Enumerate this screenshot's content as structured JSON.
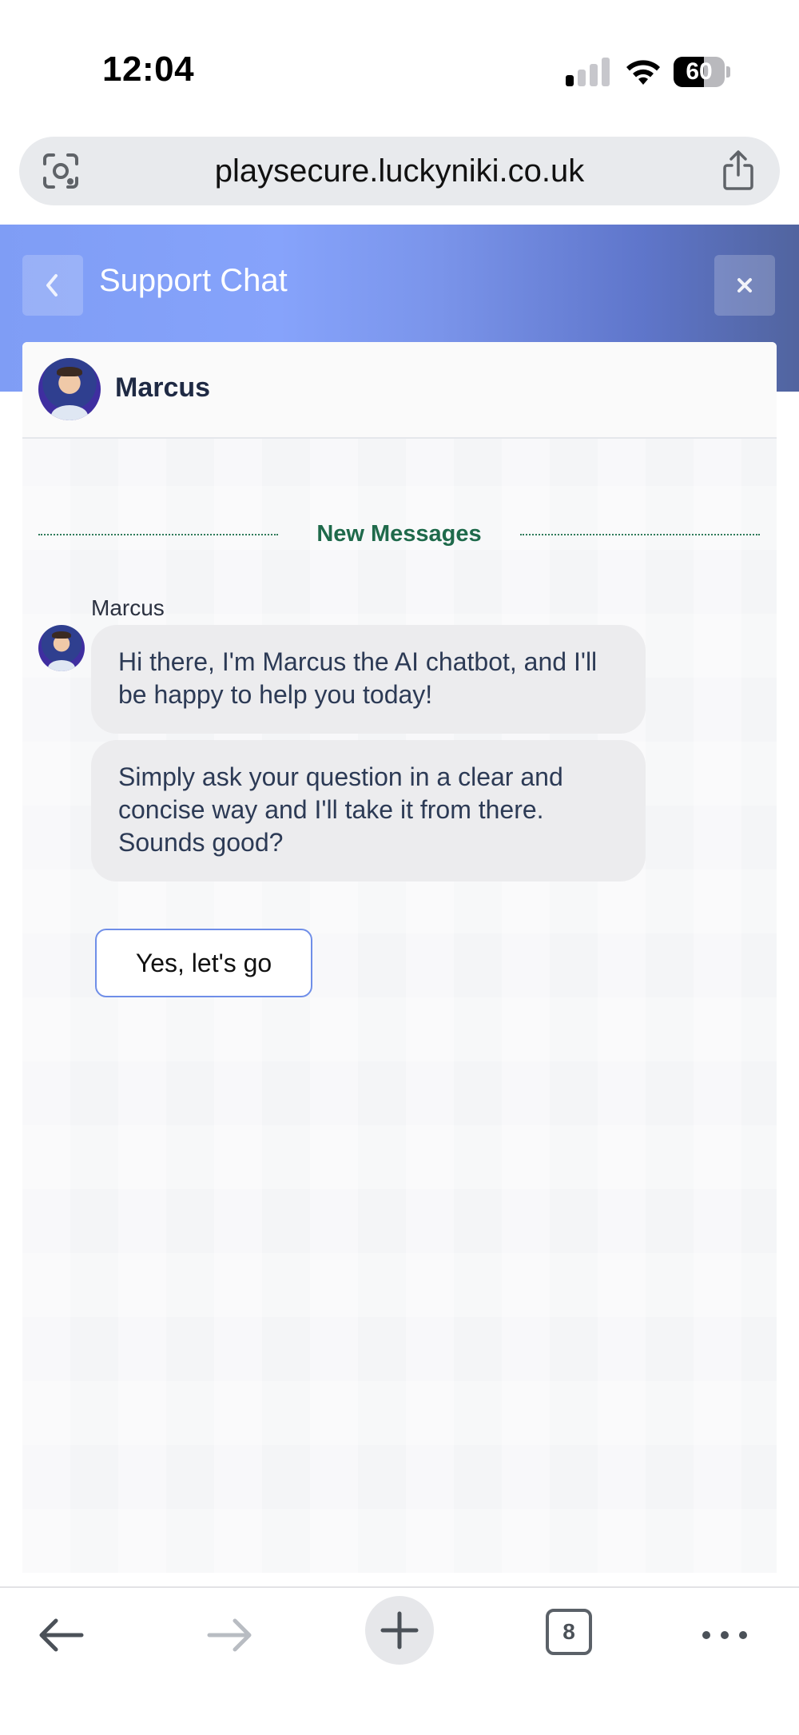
{
  "status_bar": {
    "time": "12:04",
    "battery_percent": "60",
    "battery_level": 0.6,
    "signal_bars_active": 1
  },
  "browser": {
    "url": "playsecure.luckyniki.co.uk",
    "open_tab_count": "8",
    "icons": [
      "lens-icon",
      "share-icon",
      "back-arrow-icon",
      "forward-arrow-icon",
      "plus-icon",
      "tabs-icon",
      "more-icon"
    ]
  },
  "chat": {
    "title": "Support Chat",
    "agent_name": "Marcus",
    "new_messages_label": "New Messages",
    "messages": [
      {
        "sender": "Marcus",
        "text": "Hi there, I'm Marcus the AI chatbot, and I'll be happy to help you today!"
      },
      {
        "sender": "Marcus",
        "text": "Simply ask your question in a clear and concise way and I'll take it from there. Sounds good?"
      }
    ],
    "quick_replies": [
      "Yes, let's go"
    ]
  },
  "colors": {
    "header_gradient_start": "#7f9df5",
    "header_gradient_end": "#51649f",
    "divider_accent": "#1f6a4b",
    "bubble_bg": "#ececee",
    "quick_reply_border": "#6f8ee8"
  }
}
